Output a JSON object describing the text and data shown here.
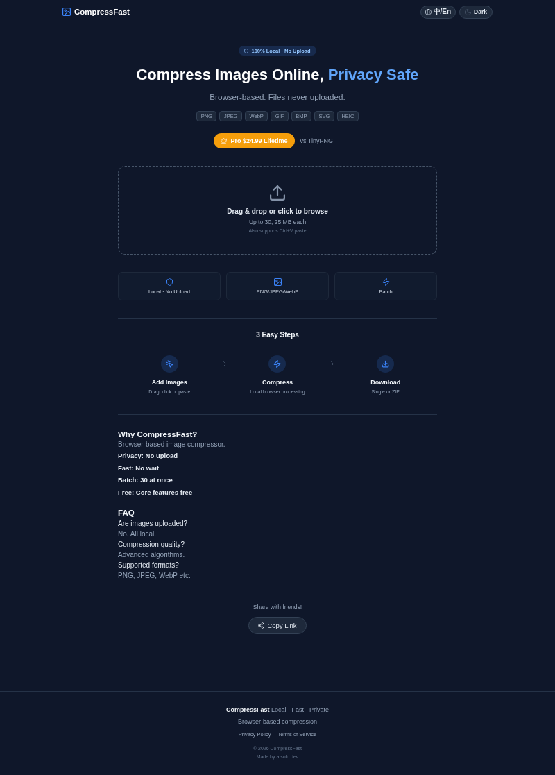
{
  "header": {
    "brand": "CompressFast",
    "buttons": [
      {
        "kind": "language",
        "label": "中/En"
      },
      {
        "kind": "theme",
        "label": "Dark"
      }
    ]
  },
  "hero": {
    "badge": "100% Local · No Upload",
    "title": "Compress Images Online,",
    "title_highlight": "Privacy Safe",
    "subtitle": "Browser-based. Files never uploaded.",
    "formats": [
      "PNG",
      "JPEG",
      "WebP",
      "GIF",
      "BMP",
      "SVG",
      "HEIC"
    ],
    "pro_button": "Pro $24.99 Lifetime",
    "compare_link": "vs TinyPNG →"
  },
  "dropzone": {
    "title": "Drag & drop or click to browse",
    "limit": "Up to 30, 25 MB each",
    "hint": "Also supports Ctrl+V paste"
  },
  "features": [
    {
      "kind": "shield",
      "label": "Local · No Upload"
    },
    {
      "kind": "image",
      "label": "PNG/JPEG/WebP"
    },
    {
      "kind": "bolt",
      "label": "Batch"
    }
  ],
  "steps": {
    "title": "3 Easy Steps",
    "items": [
      {
        "kind": "add",
        "title": "Add Images",
        "description": "Drag, click or paste"
      },
      {
        "kind": "compress",
        "title": "Compress",
        "description": "Local browser processing"
      },
      {
        "kind": "download",
        "title": "Download",
        "description": "Single or ZIP"
      }
    ]
  },
  "why": {
    "title": "Why CompressFast?",
    "description": "Browser-based image compressor.",
    "points": [
      "Privacy: No upload",
      "Fast: No wait",
      "Batch: 30 at once",
      "Free: Core features free"
    ]
  },
  "faq": {
    "title": "FAQ",
    "items": [
      {
        "question": "Are images uploaded?",
        "answer": "No. All local."
      },
      {
        "question": "Compression quality?",
        "answer": "Advanced algorithms."
      },
      {
        "question": "Supported formats?",
        "answer": "PNG, JPEG, WebP etc."
      }
    ]
  },
  "share": {
    "prompt": "Share with friends!",
    "button": "Copy Link"
  },
  "footer": {
    "tagline": "**CompressFast** Local · Fast · Private",
    "description": "Browser-based compression",
    "links": [
      "Privacy Policy",
      "Terms of Service"
    ],
    "copyright": "© 2026 CompressFast",
    "credit": "Made by a solo dev"
  }
}
